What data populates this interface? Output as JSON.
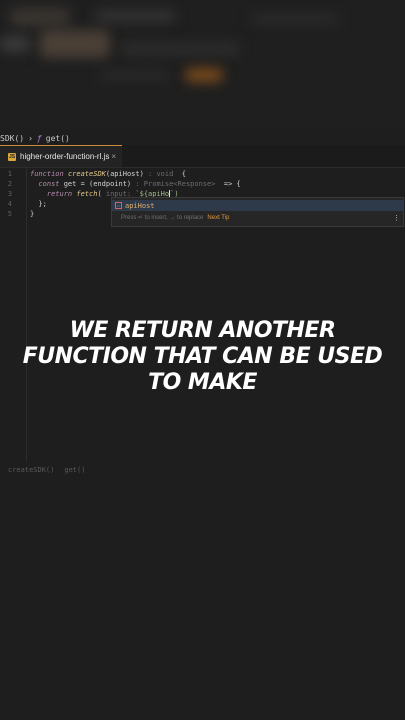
{
  "breadcrumb": {
    "items": [
      "SDK()",
      "get()"
    ],
    "separator": "›"
  },
  "tab": {
    "filename": "higher-order-function-rl.js",
    "close": "×",
    "icon_label": "JS"
  },
  "editor": {
    "lines": [
      {
        "num": "1",
        "parts": [
          {
            "t": "function ",
            "c": "kw"
          },
          {
            "t": "createSDK",
            "c": "fnname"
          },
          {
            "t": "(apiHost)",
            "c": "param"
          },
          {
            "t": " : void  ",
            "c": "hint"
          },
          {
            "t": "{",
            "c": "param"
          }
        ]
      },
      {
        "num": "2",
        "parts": [
          {
            "t": "  const ",
            "c": "kw"
          },
          {
            "t": "get = (endpoint) ",
            "c": "param"
          },
          {
            "t": ": Promise<Response> ",
            "c": "hint"
          },
          {
            "t": " => {",
            "c": "param"
          }
        ]
      },
      {
        "num": "3",
        "parts": [
          {
            "t": "    return ",
            "c": "kw"
          },
          {
            "t": "fetch",
            "c": "fnname"
          },
          {
            "t": "( ",
            "c": "param"
          },
          {
            "t": "input: ",
            "c": "hint"
          },
          {
            "t": "`${apiHo",
            "c": "str"
          }
        ]
      },
      {
        "num": "4",
        "parts": [
          {
            "t": "  };",
            "c": "param"
          }
        ]
      },
      {
        "num": "5",
        "parts": [
          {
            "t": "}",
            "c": "param"
          }
        ]
      }
    ],
    "line3_tail": "`)"
  },
  "autocomplete": {
    "item": "apiHost",
    "footer_text": "Press ↵ to insert, → to replace",
    "next_tip": "Next Tip",
    "menu": "⋮"
  },
  "status_bar": {
    "items": [
      "createSDK()",
      "get()"
    ]
  },
  "caption": {
    "lines": [
      "WE RETURN ANOTHER",
      "FUNCTION THAT CAN BE USED",
      "TO MAKE"
    ]
  }
}
